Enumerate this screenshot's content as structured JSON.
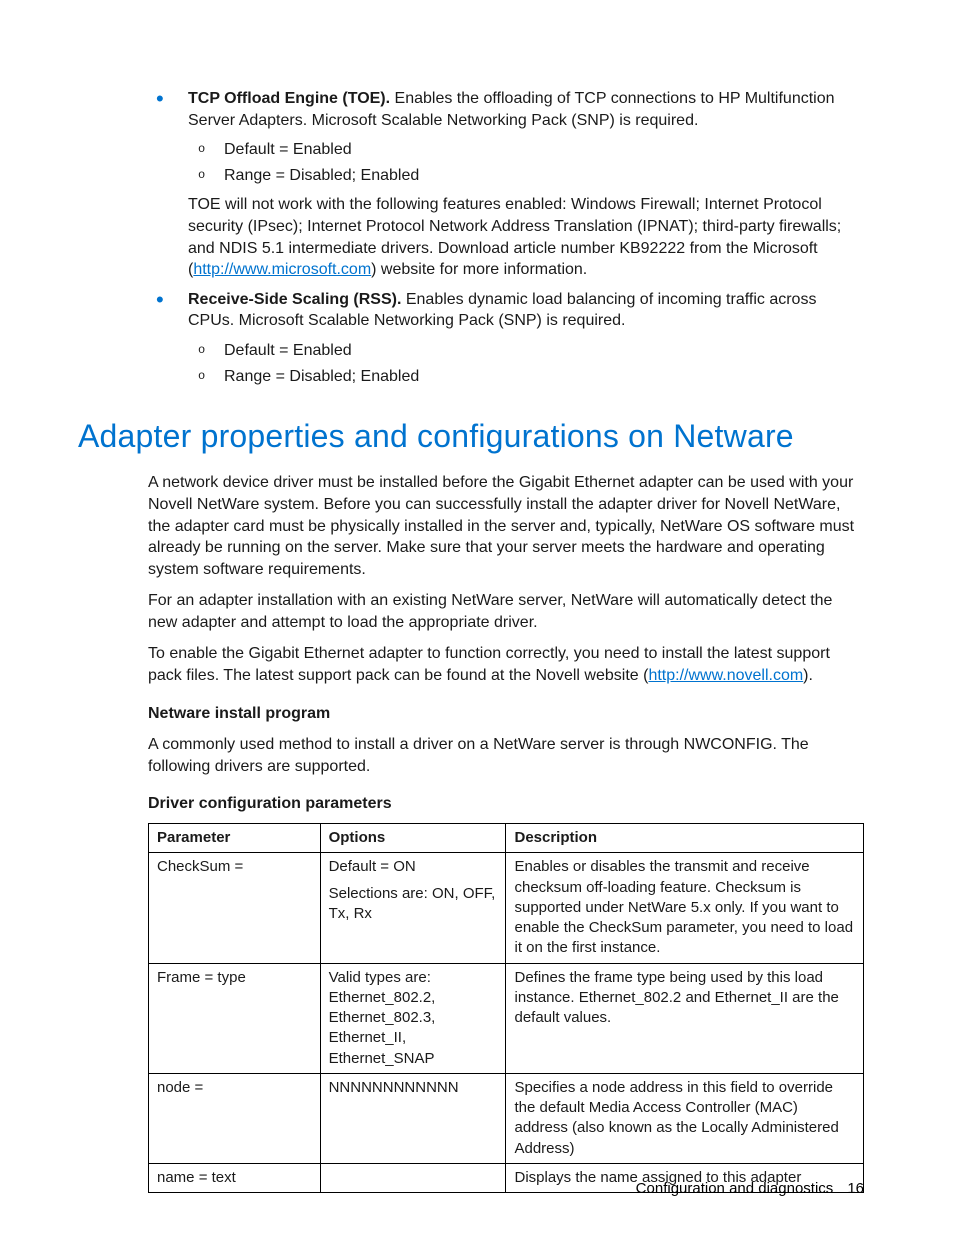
{
  "bullets": {
    "toe": {
      "title": "TCP Offload Engine (TOE).",
      "desc": "Enables the offloading of TCP connections to HP Multifunction Server Adapters. Microsoft Scalable Networking Pack (SNP) is required.",
      "sub1": "Default = Enabled",
      "sub2": "Range = Disabled; Enabled",
      "note_a": "TOE will not work with the following features enabled: Windows Firewall; Internet Protocol security (IPsec); Internet Protocol Network Address Translation (IPNAT); third-party firewalls; and NDIS 5.1 intermediate drivers. Download article number KB92222 from the Microsoft (",
      "link": "http://www.microsoft.com",
      "note_b": ") website for more information."
    },
    "rss": {
      "title": "Receive-Side Scaling (RSS).",
      "desc": "Enables dynamic load balancing of incoming traffic across CPUs. Microsoft Scalable Networking Pack (SNP) is required.",
      "sub1": "Default = Enabled",
      "sub2": "Range = Disabled; Enabled"
    }
  },
  "heading": "Adapter properties and configurations on Netware",
  "body": {
    "p1": "A network device driver must be installed before the Gigabit Ethernet adapter can be used with your Novell NetWare system. Before you can successfully install the adapter driver for Novell NetWare, the adapter card must be physically installed in the server and, typically, NetWare OS software must already be running on the server. Make sure that your server meets the hardware and operating system software requirements.",
    "p2": "For an adapter installation with an existing NetWare server, NetWare will automatically detect the new adapter and attempt to load the appropriate driver.",
    "p3a": "To enable the Gigabit Ethernet adapter to function correctly, you need to install the latest support pack files. The latest support pack can be found at the Novell website (",
    "p3link": "http://www.novell.com",
    "p3b": ").",
    "sub1": "Netware install program",
    "p4": "A commonly used method to install a driver on a NetWare server is through NWCONFIG. The following drivers are supported.",
    "sub2": "Driver configuration parameters"
  },
  "table": {
    "h1": "Parameter",
    "h2": "Options",
    "h3": "Description",
    "rows": [
      {
        "param": "CheckSum =",
        "opt1": "Default = ON",
        "opt2": "Selections are: ON, OFF, Tx, Rx",
        "desc": "Enables or disables the transmit and receive checksum off-loading feature. Checksum is supported under NetWare 5.x only. If you want to enable the CheckSum parameter, you need to load it on the first instance."
      },
      {
        "param": "Frame = type",
        "opt1": "Valid types are: Ethernet_802.2, Ethernet_802.3, Ethernet_II, Ethernet_SNAP",
        "opt2": "",
        "desc": "Defines the frame type being used by this load instance. Ethernet_802.2 and Ethernet_II are the default values."
      },
      {
        "param": "node =",
        "opt1": "NNNNNNNNNNNN",
        "opt2": "",
        "desc": "Specifies a node address in this field to override the default Media Access Controller (MAC) address (also known as the Locally Administered Address)"
      },
      {
        "param": "name = text",
        "opt1": "",
        "opt2": "",
        "desc": "Displays the name assigned to this adapter"
      }
    ]
  },
  "footer": {
    "section": "Configuration and diagnostics",
    "page": "16"
  }
}
